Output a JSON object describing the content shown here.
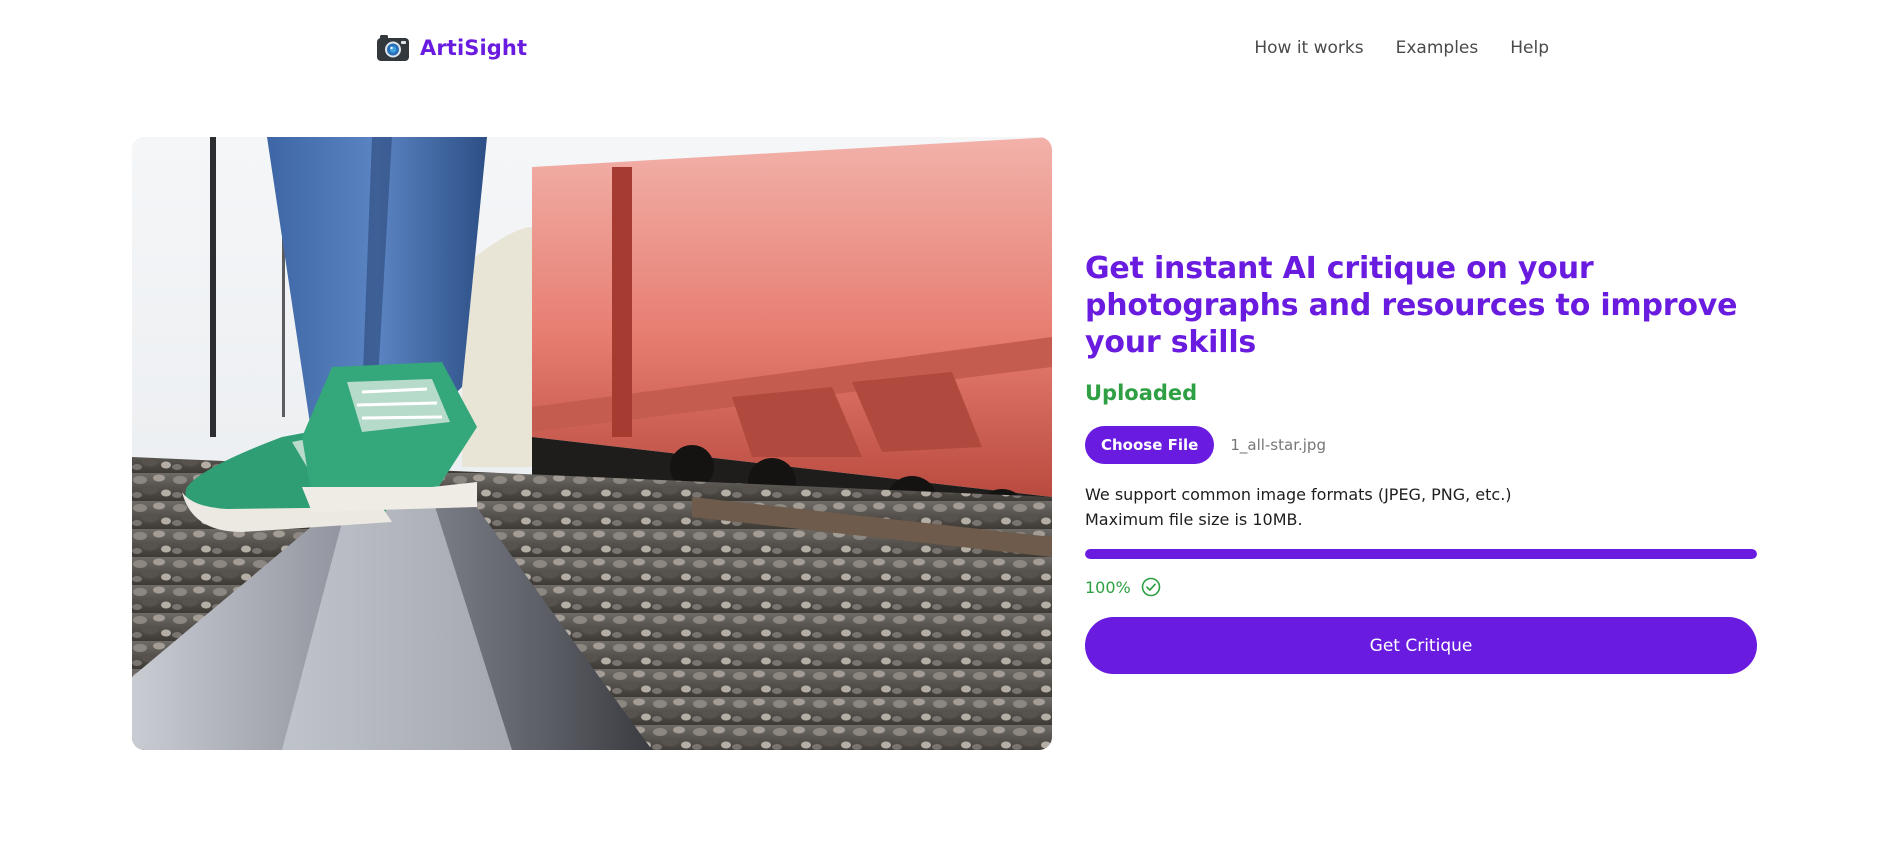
{
  "header": {
    "brand": "ArtiSight",
    "brand_icon": "camera-icon",
    "nav": [
      "How it works",
      "Examples",
      "Help"
    ]
  },
  "hero": {
    "image": "photo of green canvas sneakers balancing on a railroad track beside red freight cars"
  },
  "panel": {
    "headline": "Get instant AI critique on your photographs and resources to improve your skills",
    "status": "Uploaded",
    "choose_file_label": "Choose File",
    "file_name": "1_all-star.jpg",
    "support_line_1": "We support common image formats (JPEG, PNG, etc.)",
    "support_line_2": "Maximum file size is 10MB.",
    "progress_percent": 100,
    "progress_label": "100%",
    "complete_icon": "check-circle-icon",
    "submit_label": "Get Critique"
  },
  "colors": {
    "accent": "#6a1be0",
    "success": "#2ea043"
  }
}
